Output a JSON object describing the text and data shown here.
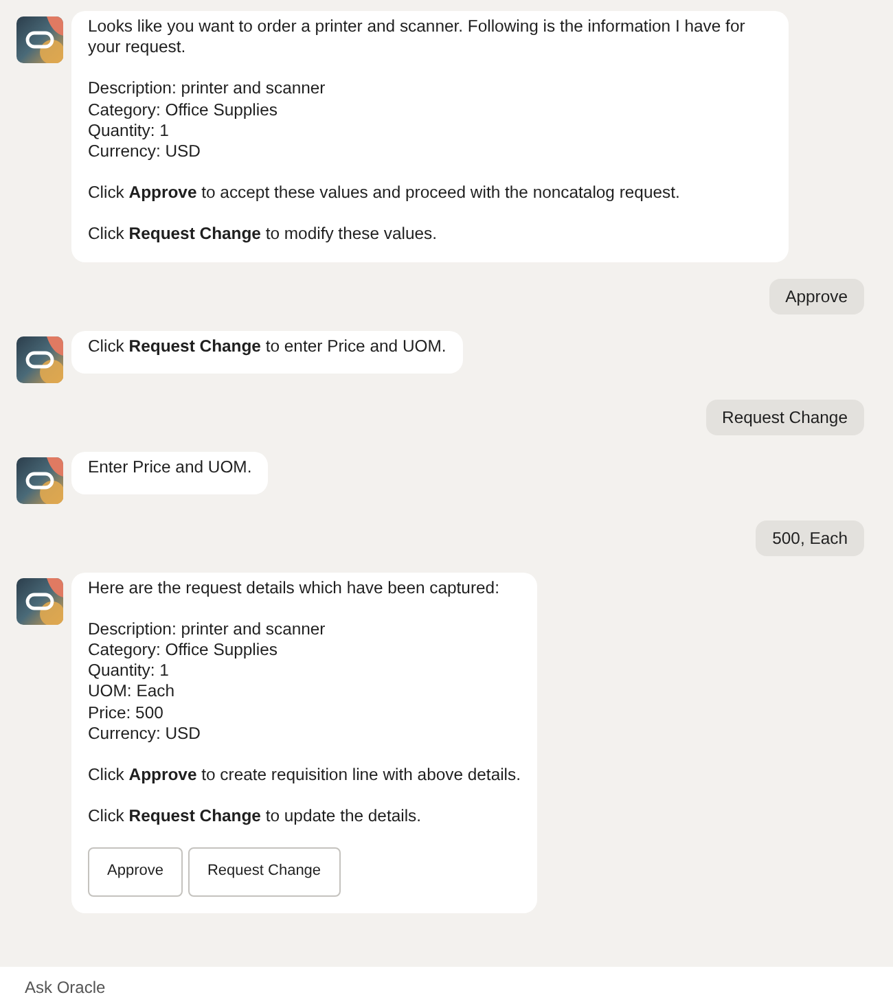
{
  "messages": [
    {
      "kind": "bot",
      "paragraphs": [
        [
          "Looks like you want to order a printer and scanner. Following is the information I have for your request."
        ],
        [
          "Description: printer and scanner",
          "Category: Office Supplies",
          "Quantity: 1",
          "Currency: USD"
        ],
        [
          "Click **Approve** to accept these values and proceed with the noncatalog request."
        ],
        [
          "Click **Request Change** to modify these values."
        ]
      ]
    },
    {
      "kind": "user",
      "text": "Approve"
    },
    {
      "kind": "bot",
      "paragraphs": [
        [
          "Click **Request Change** to enter Price and UOM."
        ]
      ]
    },
    {
      "kind": "user",
      "text": "Request Change"
    },
    {
      "kind": "bot",
      "paragraphs": [
        [
          "Enter Price and UOM."
        ]
      ]
    },
    {
      "kind": "user",
      "text": "500, Each"
    },
    {
      "kind": "bot",
      "paragraphs": [
        [
          "Here are the request details which have been captured:"
        ],
        [
          "Description: printer and scanner",
          "Category: Office Supplies",
          "Quantity: 1",
          "UOM: Each",
          "Price: 500",
          "Currency: USD"
        ],
        [
          "Click **Approve** to create requisition line with above details."
        ],
        [
          "Click **Request Change** to update the details."
        ]
      ],
      "buttons": [
        "Approve",
        "Request Change"
      ]
    }
  ],
  "input": {
    "placeholder": "Ask Oracle"
  }
}
